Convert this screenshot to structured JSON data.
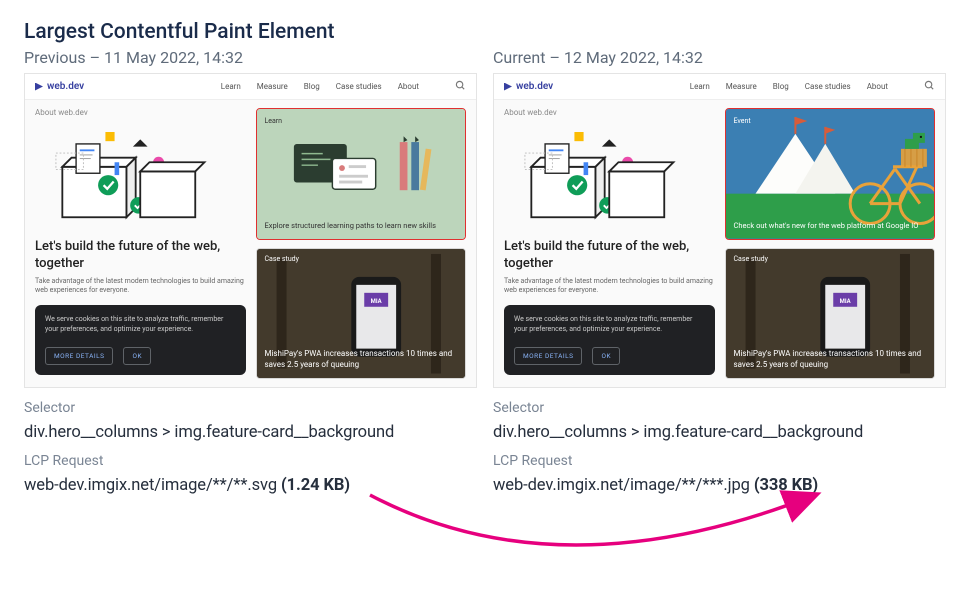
{
  "title": "Largest Contentful Paint Element",
  "panes": {
    "prev": {
      "header": "Previous – 11 May 2022, 14:32"
    },
    "curr": {
      "header": "Current – 12 May 2022, 14:32"
    }
  },
  "shot": {
    "brand": "web.dev",
    "nav": {
      "learn": "Learn",
      "measure": "Measure",
      "blog": "Blog",
      "cases": "Case studies",
      "about": "About"
    },
    "about_label": "About web.dev",
    "hero_heading": "Let's build the future of the web, together",
    "hero_sub": "Take advantage of the latest modern technologies to build amazing web experiences for everyone.",
    "cookie": {
      "text": "We serve cookies on this site to analyze traffic, remember your preferences, and optimize your experience.",
      "more": "MORE DETAILS",
      "ok": "OK"
    },
    "learn_card": {
      "label": "Learn",
      "caption": "Explore structured learning paths to learn new skills"
    },
    "event_card": {
      "label": "Event",
      "caption": "Check out what's new for the web platform at Google IO"
    },
    "case_card": {
      "label": "Case study",
      "caption": "MishiPay's PWA increases transactions 10 times and saves 2.5 years of queuing"
    }
  },
  "info": {
    "selector_label": "Selector",
    "selector_value": "div.hero__columns > img.feature-card__background",
    "lcp_label": "LCP Request",
    "prev_req": "web-dev.imgix.net/image/**/**.svg ",
    "prev_size": "(1.24 KB)",
    "curr_req": "web-dev.imgix.net/image/**/***.jpg ",
    "curr_size": "(338 KB)"
  }
}
